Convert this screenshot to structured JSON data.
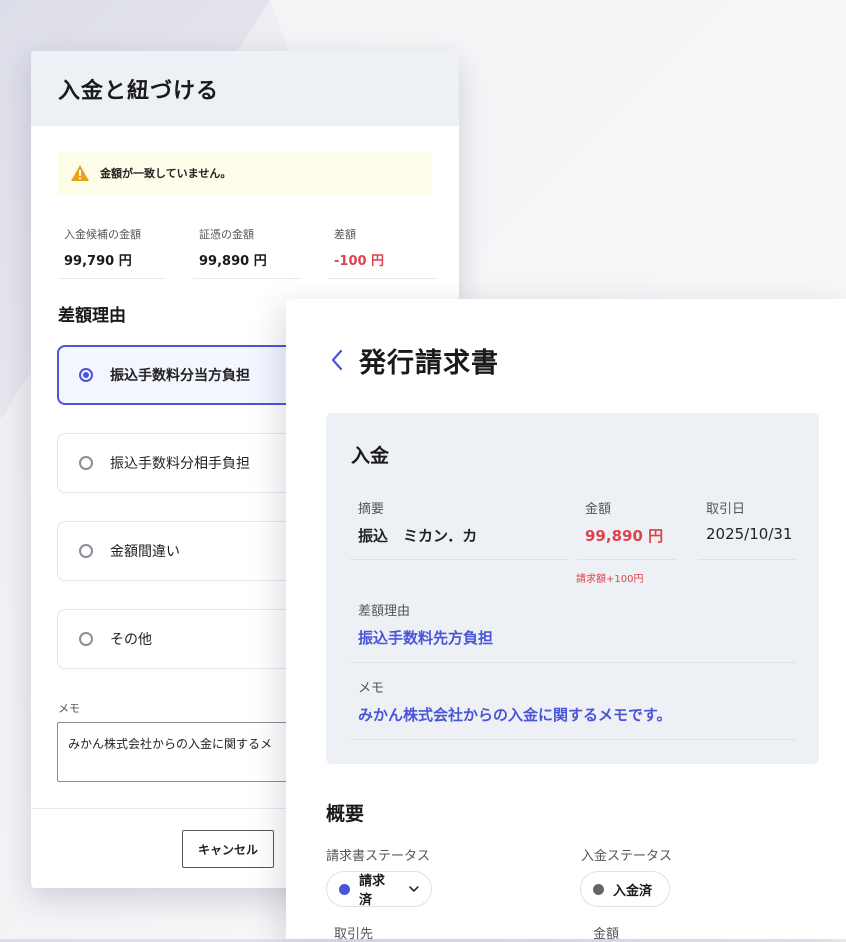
{
  "colors": {
    "accent": "#4b55d8",
    "negative": "#e0424a",
    "warning": "#e8a31a",
    "neutral_status": "#666666"
  },
  "modal": {
    "title": "入金と紐づける",
    "alert": {
      "icon": "warning-triangle-icon",
      "text": "金額が一致していません。"
    },
    "amounts": [
      {
        "label": "入金候補の金額",
        "value": "99,790 円"
      },
      {
        "label": "証憑の金額",
        "value": "99,890 円"
      },
      {
        "label": "差額",
        "value": "-100 円"
      }
    ],
    "reason_title": "差額理由",
    "reasons": [
      {
        "label": "振込手数料分当方負担",
        "selected": true
      },
      {
        "label": "振込手数料分相手負担",
        "selected": false
      },
      {
        "label": "金額間違い",
        "selected": false
      },
      {
        "label": "その他",
        "selected": false
      }
    ],
    "memo_label": "メモ",
    "memo_value": "みかん株式会社からの入金に関するメ",
    "cancel_label": "キャンセル"
  },
  "panel": {
    "back_icon": "chevron-left-icon",
    "title": "発行請求書",
    "payment": {
      "title": "入金",
      "summary_label": "摘要",
      "summary_value": "振込　ミカン．カ",
      "amount_label": "金額",
      "amount_value": "99,890 円",
      "date_label": "取引日",
      "date_value": "2025/10/31",
      "diff_note": "請求額+100円",
      "reason_label": "差額理由",
      "reason_value": "振込手数料先方負担",
      "memo_label": "メモ",
      "memo_value": "みかん株式会社からの入金に関するメモです。"
    },
    "overview": {
      "title": "概要",
      "invoice_status_label": "請求書ステータス",
      "invoice_status_value": "請求済",
      "payment_status_label": "入金ステータス",
      "payment_status_value": "入金済",
      "partner_label": "取引先",
      "amount_label": "金額"
    }
  }
}
